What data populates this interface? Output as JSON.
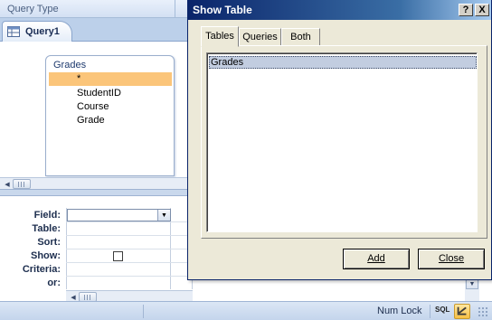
{
  "ribbon": {
    "group_label": "Query Type"
  },
  "document_tab": {
    "label": "Query1"
  },
  "table_box": {
    "title": "Grades",
    "fields": [
      "*",
      "StudentID",
      "Course",
      "Grade"
    ],
    "selected_index": 0
  },
  "grid": {
    "row_labels": [
      "Field:",
      "Table:",
      "Sort:",
      "Show:",
      "Criteria:",
      "or:"
    ]
  },
  "statusbar": {
    "numlock": "Num Lock",
    "sql": "SQL"
  },
  "dialog": {
    "title": "Show Table",
    "help_btn": "?",
    "close_btn": "X",
    "tabs": [
      "Tables",
      "Queries",
      "Both"
    ],
    "active_tab": "Tables",
    "list_items": [
      "Grades"
    ],
    "add_label": "Add",
    "close_label": "Close"
  },
  "colors": {
    "title_bar": "#0a246a",
    "selected_field": "#fbc57a",
    "selected_list_item": "#c2cde0"
  }
}
